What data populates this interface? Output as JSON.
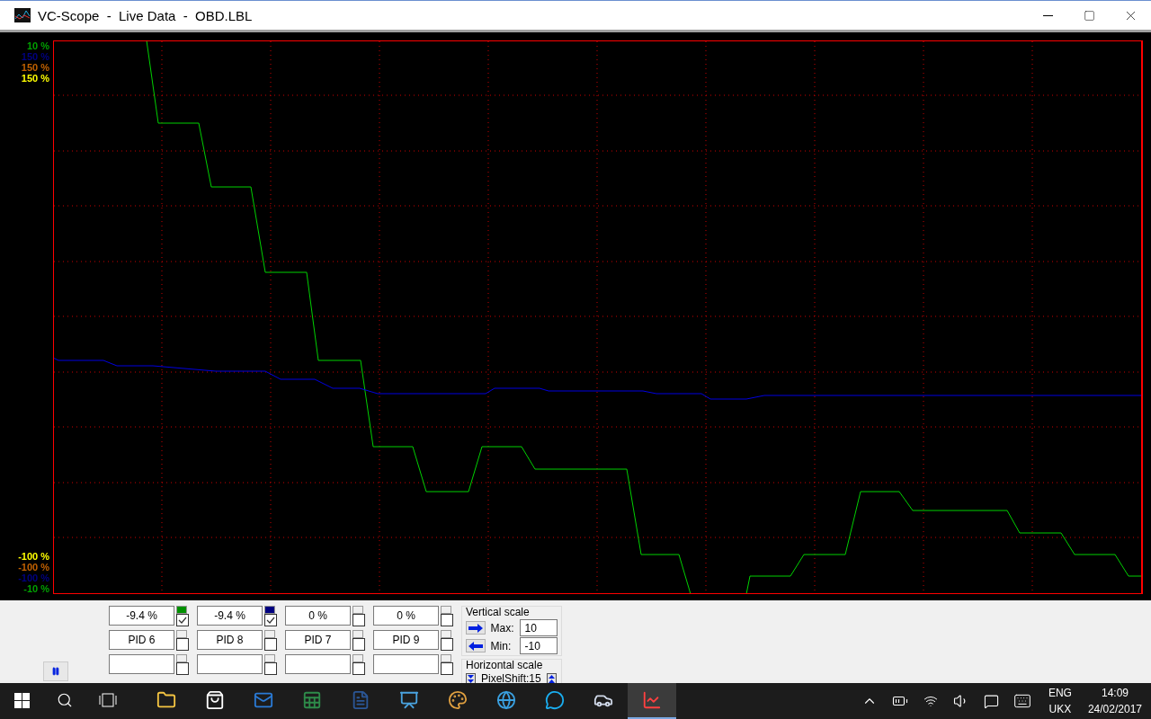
{
  "window": {
    "title": "VC-Scope  -  Live Data  -  OBD.LBL"
  },
  "scope": {
    "top_labels": [
      {
        "text": "10 %",
        "color": "#00a000"
      },
      {
        "text": "150 %",
        "color": "#000080"
      },
      {
        "text": "150 %",
        "color": "#c06000"
      },
      {
        "text": "150 %",
        "color": "#ffff00"
      }
    ],
    "bottom_labels": [
      {
        "text": "-100 %",
        "color": "#ffff00"
      },
      {
        "text": "-100 %",
        "color": "#c06000"
      },
      {
        "text": "-100 %",
        "color": "#000080"
      },
      {
        "text": "-10 %",
        "color": "#00a000"
      }
    ]
  },
  "channels": [
    {
      "value": "-9.4 %",
      "color": "#009000",
      "checked": true,
      "name": "PID 6",
      "name_checked": false,
      "extra_checked": false
    },
    {
      "value": "-9.4 %",
      "color": "#000080",
      "checked": true,
      "name": "PID 8",
      "name_checked": false,
      "extra_checked": false
    },
    {
      "value": "0 %",
      "checked": false,
      "name": "PID 7",
      "name_checked": false,
      "extra_checked": false
    },
    {
      "value": "0 %",
      "checked": false,
      "name": "PID 9",
      "name_checked": false,
      "extra_checked": false
    }
  ],
  "vertical_scale": {
    "title": "Vertical scale",
    "max_label": "Max:",
    "max": "10",
    "min_label": "Min:",
    "min": "-10"
  },
  "horizontal_scale": {
    "title": "Horizontal scale",
    "pixel_shift": "PixelShift:15"
  },
  "taskbar": {
    "apps": [
      {
        "kind": "folder",
        "selected": false
      },
      {
        "kind": "store",
        "selected": false
      },
      {
        "kind": "mail",
        "selected": false
      },
      {
        "kind": "sheet",
        "selected": false
      },
      {
        "kind": "document",
        "selected": false
      },
      {
        "kind": "presentation",
        "selected": false
      },
      {
        "kind": "palette",
        "selected": false
      },
      {
        "kind": "globe",
        "selected": false
      },
      {
        "kind": "chat",
        "selected": false
      },
      {
        "kind": "car",
        "selected": false
      },
      {
        "kind": "scope",
        "selected": true
      }
    ],
    "language": "ENG",
    "layout": "UKX",
    "time": "14:09",
    "date": "24/02/2017"
  }
}
